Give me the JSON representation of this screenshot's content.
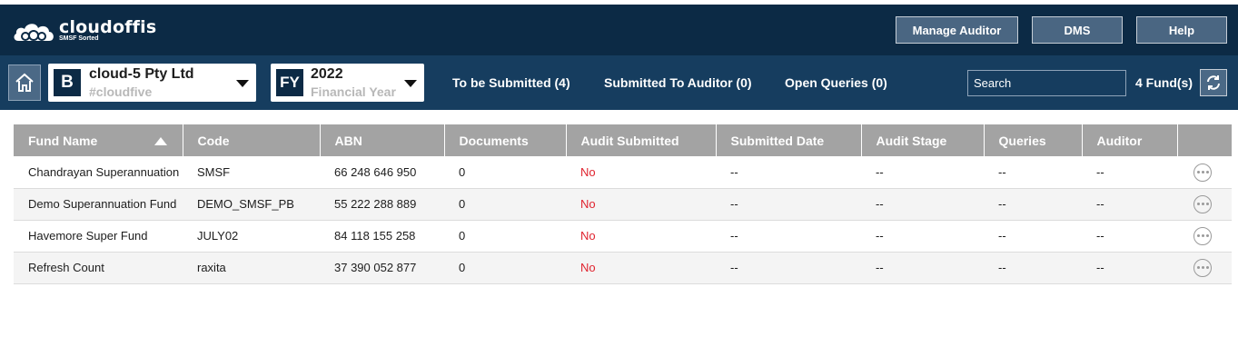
{
  "brand": {
    "name": "cloudoffis",
    "tagline": "SMSF Sorted"
  },
  "header": {
    "buttons": {
      "manage_auditor": "Manage Auditor",
      "dms": "DMS",
      "help": "Help"
    }
  },
  "subbar": {
    "company": {
      "badge": "B",
      "name": "cloud-5 Pty Ltd",
      "code": "#cloudfive"
    },
    "year": {
      "badge": "FY",
      "value": "2022",
      "label": "Financial Year"
    },
    "tabs": [
      "To be Submitted (4)",
      "Submitted To Auditor (0)",
      "Open Queries (0)"
    ],
    "search_placeholder": "Search",
    "fund_count": "4 Fund(s)"
  },
  "table": {
    "columns": [
      "Fund Name",
      "Code",
      "ABN",
      "Documents",
      "Audit Submitted",
      "Submitted Date",
      "Audit Stage",
      "Queries",
      "Auditor",
      ""
    ],
    "rows": [
      {
        "fund": "Chandrayan Superannuation",
        "code": "SMSF",
        "abn": "66 248 646 950",
        "docs": "0",
        "submitted": "No",
        "date": "--",
        "stage": "--",
        "queries": "--",
        "auditor": "--"
      },
      {
        "fund": "Demo Superannuation Fund",
        "code": "DEMO_SMSF_PB",
        "abn": "55 222 288 889",
        "docs": "0",
        "submitted": "No",
        "date": "--",
        "stage": "--",
        "queries": "--",
        "auditor": "--"
      },
      {
        "fund": "Havemore Super Fund",
        "code": "JULY02",
        "abn": "84 118 155 258",
        "docs": "0",
        "submitted": "No",
        "date": "--",
        "stage": "--",
        "queries": "--",
        "auditor": "--"
      },
      {
        "fund": "Refresh Count",
        "code": "raxita",
        "abn": "37 390 052 877",
        "docs": "0",
        "submitted": "No",
        "date": "--",
        "stage": "--",
        "queries": "--",
        "auditor": "--"
      }
    ]
  },
  "icons": {
    "home": "home-icon",
    "refresh": "refresh-icon",
    "sort": "sort-asc-icon",
    "more": "more-options-icon",
    "logo": "cloud-logo-icon"
  },
  "colors": {
    "header_bg": "#0c2a45",
    "subbar_bg": "#163d5f",
    "button_bg": "#4a6682",
    "table_header": "#a3a3a3",
    "no_status": "#e0242f"
  }
}
